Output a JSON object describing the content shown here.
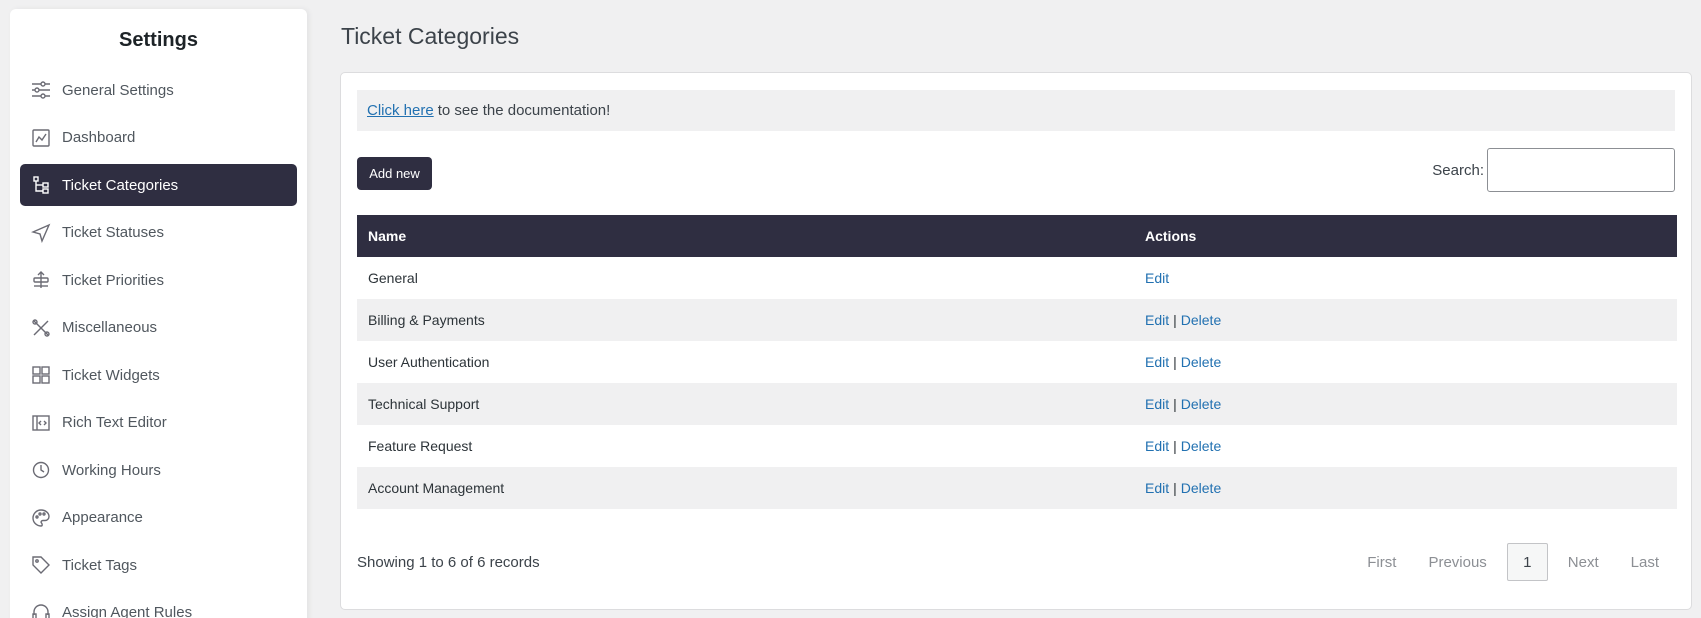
{
  "sidebar": {
    "title": "Settings",
    "items": [
      {
        "label": "General Settings",
        "icon": "sliders-icon"
      },
      {
        "label": "Dashboard",
        "icon": "chart-icon"
      },
      {
        "label": "Ticket Categories",
        "icon": "tree-icon",
        "active": true
      },
      {
        "label": "Ticket Statuses",
        "icon": "send-icon"
      },
      {
        "label": "Ticket Priorities",
        "icon": "priority-icon"
      },
      {
        "label": "Miscellaneous",
        "icon": "tools-icon"
      },
      {
        "label": "Ticket Widgets",
        "icon": "widgets-icon"
      },
      {
        "label": "Rich Text Editor",
        "icon": "code-icon"
      },
      {
        "label": "Working Hours",
        "icon": "clock-icon"
      },
      {
        "label": "Appearance",
        "icon": "palette-icon"
      },
      {
        "label": "Ticket Tags",
        "icon": "tag-icon"
      },
      {
        "label": "Assign Agent Rules",
        "icon": "headset-icon"
      }
    ]
  },
  "main": {
    "title": "Ticket Categories",
    "notice": {
      "link_text": "Click here",
      "text": "to see the documentation!"
    },
    "add_button": "Add new",
    "search_label": "Search:",
    "search_value": "",
    "table": {
      "headers": [
        "Name",
        "Actions"
      ],
      "edit_label": "Edit",
      "delete_label": "Delete",
      "rows": [
        {
          "name": "General",
          "deletable": false
        },
        {
          "name": "Billing & Payments",
          "deletable": true
        },
        {
          "name": "User Authentication",
          "deletable": true
        },
        {
          "name": "Technical Support",
          "deletable": true
        },
        {
          "name": "Feature Request",
          "deletable": true
        },
        {
          "name": "Account Management",
          "deletable": true
        }
      ]
    },
    "records_text": "Showing 1 to 6 of 6 records",
    "pagination": {
      "first": "First",
      "previous": "Previous",
      "current": "1",
      "next": "Next",
      "last": "Last"
    }
  },
  "colors": {
    "accent": "#2f2e41",
    "link": "#2271b1",
    "background": "#f0f0f1"
  }
}
